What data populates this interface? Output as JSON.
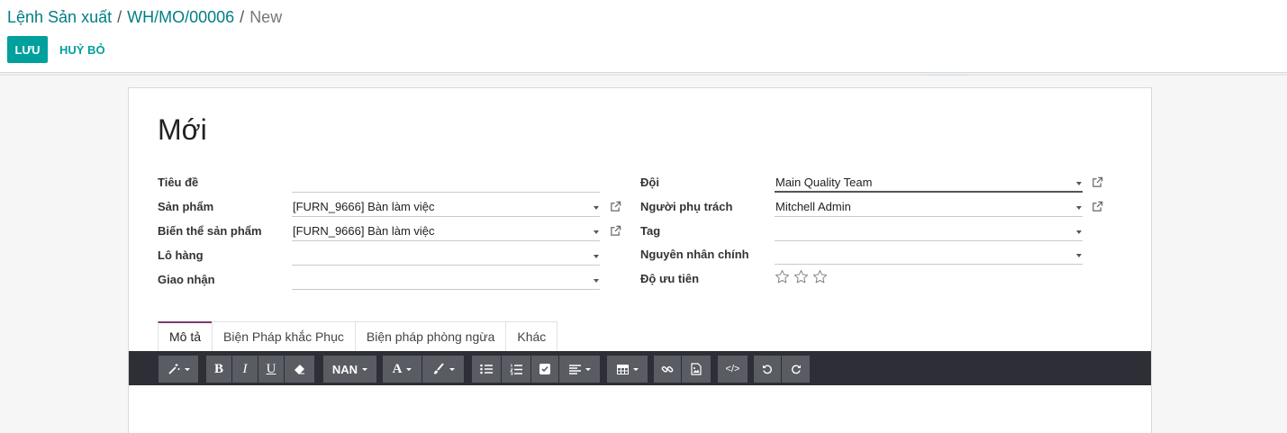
{
  "breadcrumb": {
    "items": [
      "Lệnh Sản xuất",
      "WH/MO/00006"
    ],
    "separator": "/",
    "current": "New"
  },
  "buttons": {
    "save": "LƯU",
    "discard": "HUỶ BỎ"
  },
  "form": {
    "title": "Mới",
    "left": {
      "title_label": "Tiêu đề",
      "title_value": "",
      "product_label": "Sản phẩm",
      "product_value": "[FURN_9666] Bàn làm việc",
      "variant_label": "Biến thể sản phẩm",
      "variant_value": "[FURN_9666] Bàn làm việc",
      "lot_label": "Lô hàng",
      "lot_value": "",
      "picking_label": "Giao nhận",
      "picking_value": ""
    },
    "right": {
      "team_label": "Đội",
      "team_value": "Main Quality Team",
      "responsible_label": "Người phụ trách",
      "responsible_value": "Mitchell Admin",
      "tag_label": "Tag",
      "tag_value": "",
      "root_cause_label": "Nguyên nhân chính",
      "root_cause_value": "",
      "priority_label": "Độ ưu tiên",
      "priority_stars": 0,
      "priority_max": 3
    }
  },
  "tabs": [
    "Mô tả",
    "Biện Pháp khắc Phục",
    "Biện pháp phòng ngừa",
    "Khác"
  ],
  "toolbar": {
    "font_size": "NAN",
    "icons": [
      "magic-icon",
      "bold-icon",
      "italic-icon",
      "underline-icon",
      "eraser-icon",
      "font-color-icon",
      "brush-icon",
      "unordered-list-icon",
      "ordered-list-icon",
      "checklist-icon",
      "align-icon",
      "table-icon",
      "link-icon",
      "image-icon",
      "code-view-icon",
      "undo-icon",
      "redo-icon"
    ]
  },
  "colors": {
    "primary": "#00a09d",
    "link": "#017e84",
    "tab_accent": "#7c3a6b",
    "toolbar_bg": "#2e2f36",
    "toolbar_button": "#5a5c63"
  }
}
